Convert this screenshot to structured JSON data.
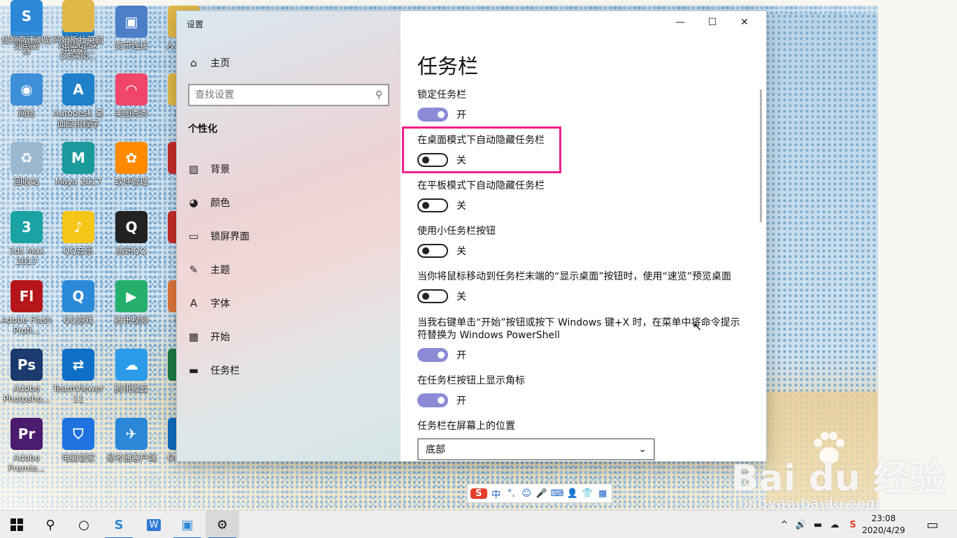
{
  "desktop_icons": [
    {
      "label": "此电脑",
      "color": "#3d8fd8",
      "glyph": "▭"
    },
    {
      "label": "Autodesk Deskto...",
      "color": "#1f7fc8",
      "glyph": "A"
    },
    {
      "label": "宽带连接",
      "color": "#4d7fc8",
      "glyph": "▣"
    },
    {
      "label": "人才 名说",
      "color": "#e0b84a",
      "glyph": ""
    },
    {
      "label": "网络",
      "color": "#3d8fd8",
      "glyph": "◉"
    },
    {
      "label": "Autodesk 桌面应用程序",
      "color": "#1f7fc8",
      "glyph": "A"
    },
    {
      "label": "美图秀秀",
      "color": "#f0466a",
      "glyph": "◠"
    },
    {
      "label": "新建",
      "color": "#e0b84a",
      "glyph": ""
    },
    {
      "label": "回收站",
      "color": "#9ab8d0",
      "glyph": "♻"
    },
    {
      "label": "Maya 2017",
      "color": "#1a9a9a",
      "glyph": "M"
    },
    {
      "label": "软件管理",
      "color": "#ff8a00",
      "glyph": "✿"
    },
    {
      "label": "Ac",
      "color": "#c52b2b",
      "glyph": "A"
    },
    {
      "label": "3ds Max 2017",
      "color": "#1aa3a3",
      "glyph": "3"
    },
    {
      "label": "QQ音乐",
      "color": "#f5c518",
      "glyph": "♪"
    },
    {
      "label": "腾讯QQ",
      "color": "#222222",
      "glyph": "Q"
    },
    {
      "label": "Ac",
      "color": "#c52b2b",
      "glyph": "A"
    },
    {
      "label": "Adobe Flash Profi...",
      "color": "#b5161b",
      "glyph": "Fl"
    },
    {
      "label": "QQ游戏",
      "color": "#2b8ad8",
      "glyph": "Q"
    },
    {
      "label": "腾讯视频",
      "color": "#24b06b",
      "glyph": "▶"
    },
    {
      "label": "Disk",
      "color": "#e0773a",
      "glyph": "D"
    },
    {
      "label": "Adobe Photosho...",
      "color": "#1b3a6e",
      "glyph": "Ps"
    },
    {
      "label": "TeamViewer 11",
      "color": "#0e6fc7",
      "glyph": "⇄"
    },
    {
      "label": "腾讯微云",
      "color": "#2b9ae8",
      "glyph": "☁"
    },
    {
      "label": "E",
      "color": "#1e7a45",
      "glyph": "X"
    },
    {
      "label": "Adobe Premie...",
      "color": "#4b1b6e",
      "glyph": "Pr"
    },
    {
      "label": "电脑管家",
      "color": "#1e73e0",
      "glyph": "⛉"
    },
    {
      "label": "易考通客户端",
      "color": "#2b88d8",
      "glyph": "✈"
    },
    {
      "label": "Outlook",
      "color": "#0f6cbd",
      "glyph": "O"
    },
    {
      "label": "搜狗高速浏览器",
      "color": "#2b88d8",
      "glyph": "S"
    },
    {
      "label": "阿姆斯壮英题中英对...",
      "color": "#e0b84a",
      "glyph": ""
    }
  ],
  "window": {
    "title": "设置",
    "controls": {
      "minimize": "—",
      "maximize": "☐",
      "close": "✕"
    }
  },
  "nav": {
    "home_label": "主页",
    "search_placeholder": "查找设置",
    "section_title": "个性化",
    "items": [
      {
        "label": "背景",
        "icon": "image-icon"
      },
      {
        "label": "颜色",
        "icon": "palette-icon"
      },
      {
        "label": "锁屏界面",
        "icon": "lockscreen-icon"
      },
      {
        "label": "主题",
        "icon": "theme-icon"
      },
      {
        "label": "字体",
        "icon": "font-icon"
      },
      {
        "label": "开始",
        "icon": "start-icon"
      },
      {
        "label": "任务栏",
        "icon": "taskbar-icon"
      }
    ]
  },
  "content": {
    "page_title": "任务栏",
    "settings": [
      {
        "label": "锁定任务栏",
        "state": "开",
        "on": true
      },
      {
        "label": "在桌面模式下自动隐藏任务栏",
        "state": "关",
        "on": false
      },
      {
        "label": "在平板模式下自动隐藏任务栏",
        "state": "关",
        "on": false
      },
      {
        "label": "使用小任务栏按钮",
        "state": "关",
        "on": false
      },
      {
        "label": "当你将鼠标移动到任务栏末端的“显示桌面”按钮时，使用“速览”预览桌面",
        "state": "关",
        "on": false
      },
      {
        "label": "当我右键单击“开始”按钮或按下 Windows 键+X 时，在菜单中将命令提示符替换为 Windows PowerShell",
        "state": "开",
        "on": true
      },
      {
        "label": "在任务栏按钮上显示角标",
        "state": "开",
        "on": true
      }
    ],
    "position_label": "任务栏在屏幕上的位置",
    "position_value": "底部",
    "highlight_color": "#f21f8c",
    "toggle_on_color": "#8b8bd6"
  },
  "ime_bar": [
    "S",
    "中",
    "°,",
    "☺",
    "🎤",
    "⌨",
    "👤",
    "👕",
    "▦"
  ],
  "taskbar": {
    "clock_time": "23:08",
    "clock_date": "2020/4/29",
    "tray_icons": [
      "^",
      "🔊",
      "▬",
      "☁",
      "S"
    ]
  },
  "watermark": {
    "main": "Bai du 经验",
    "sub": "jingyan.baidu.com"
  }
}
